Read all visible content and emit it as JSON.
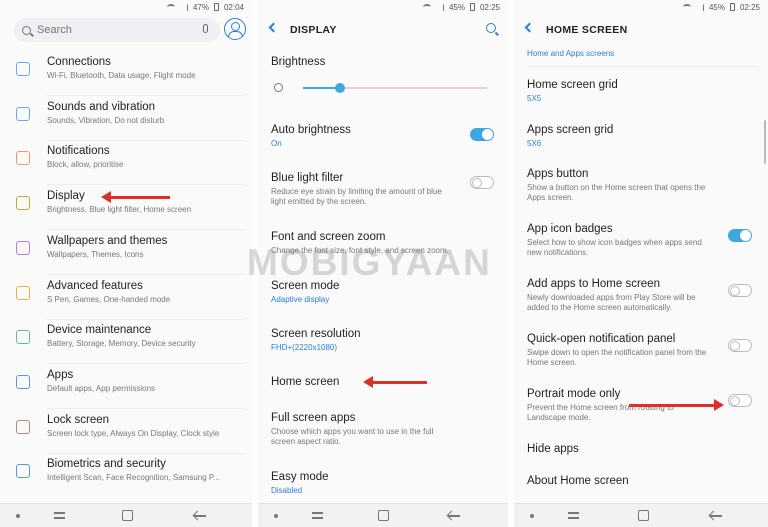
{
  "watermark": "MOBIGYAAN",
  "panel1": {
    "status": {
      "battery": "47%",
      "time": "02:04"
    },
    "search": {
      "placeholder": "Search"
    },
    "items": [
      {
        "title": "Connections",
        "sub": "Wi-Fi, Bluetooth, Data usage, Flight mode",
        "icon": "connections-icon"
      },
      {
        "title": "Sounds and vibration",
        "sub": "Sounds, Vibration, Do not disturb",
        "icon": "sound-icon"
      },
      {
        "title": "Notifications",
        "sub": "Block, allow, prioritise",
        "icon": "notifications-icon"
      },
      {
        "title": "Display",
        "sub": "Brightness, Blue light filter, Home screen",
        "icon": "display-icon"
      },
      {
        "title": "Wallpapers and themes",
        "sub": "Wallpapers, Themes, Icons",
        "icon": "brush-icon"
      },
      {
        "title": "Advanced features",
        "sub": "S Pen, Games, One-handed mode",
        "icon": "gear-plus-icon"
      },
      {
        "title": "Device maintenance",
        "sub": "Battery, Storage, Memory, Device security",
        "icon": "maintenance-icon"
      },
      {
        "title": "Apps",
        "sub": "Default apps, App permissions",
        "icon": "apps-grid-icon"
      },
      {
        "title": "Lock screen",
        "sub": "Screen lock type, Always On Display, Clock style",
        "icon": "lock-icon"
      },
      {
        "title": "Biometrics and security",
        "sub": "Intelligent Scan, Face Recognition, Samsung P...",
        "icon": "shield-icon"
      }
    ]
  },
  "panel2": {
    "status": {
      "battery": "45%",
      "time": "02:25"
    },
    "header": "DISPLAY",
    "brightness_label": "Brightness",
    "brightness_level": 0.2,
    "items": [
      {
        "title": "Auto brightness",
        "sub": "On",
        "sub_blue": true,
        "toggle": "on"
      },
      {
        "title": "Blue light filter",
        "sub": "Reduce eye strain by limiting the amount of blue light emitted by the screen.",
        "sub_blue": false,
        "toggle": "off"
      },
      {
        "title": "Font and screen zoom",
        "sub": "Change the font size, font style, and screen zoom.",
        "sub_blue": false,
        "toggle": null
      },
      {
        "title": "Screen mode",
        "sub": "Adaptive display",
        "sub_blue": true,
        "toggle": null
      },
      {
        "title": "Screen resolution",
        "sub": "FHD+(2220x1080)",
        "sub_blue": true,
        "toggle": null
      },
      {
        "title": "Home screen",
        "sub": "",
        "sub_blue": false,
        "toggle": null
      },
      {
        "title": "Full screen apps",
        "sub": "Choose which apps you want to use in the full screen aspect ratio.",
        "sub_blue": false,
        "toggle": null
      },
      {
        "title": "Easy mode",
        "sub": "Disabled",
        "sub_blue": true,
        "toggle": null
      }
    ]
  },
  "panel3": {
    "status": {
      "battery": "45%",
      "time": "02:25"
    },
    "header": "HOME SCREEN",
    "top_partial": "Home and Apps screens",
    "items": [
      {
        "title": "Home screen grid",
        "sub": "5X5",
        "sub_blue": true,
        "toggle": null
      },
      {
        "title": "Apps screen grid",
        "sub": "5X6",
        "sub_blue": true,
        "toggle": null
      },
      {
        "title": "Apps button",
        "sub": "Show a button on the Home screen that opens the Apps screen.",
        "sub_blue": false,
        "toggle": null
      },
      {
        "title": "App icon badges",
        "sub": "Select how to show icon badges when apps send new notifications.",
        "sub_blue": false,
        "toggle": "on"
      },
      {
        "title": "Add apps to Home screen",
        "sub": "Newly downloaded apps from Play Store will be added to the Home screen automatically.",
        "sub_blue": false,
        "toggle": "off"
      },
      {
        "title": "Quick-open notification panel",
        "sub": "Swipe down to open the notification panel from the Home screen.",
        "sub_blue": false,
        "toggle": "off"
      },
      {
        "title": "Portrait mode only",
        "sub": "Prevent the Home screen from rotating to Landscape mode.",
        "sub_blue": false,
        "toggle": "off"
      },
      {
        "title": "Hide apps",
        "sub": "",
        "sub_blue": false,
        "toggle": null
      },
      {
        "title": "About Home screen",
        "sub": "",
        "sub_blue": false,
        "toggle": null
      }
    ]
  },
  "colors": {
    "accent": "#3ea6e0",
    "arrow": "#d9322b",
    "blue_text": "#2b7fd4"
  }
}
